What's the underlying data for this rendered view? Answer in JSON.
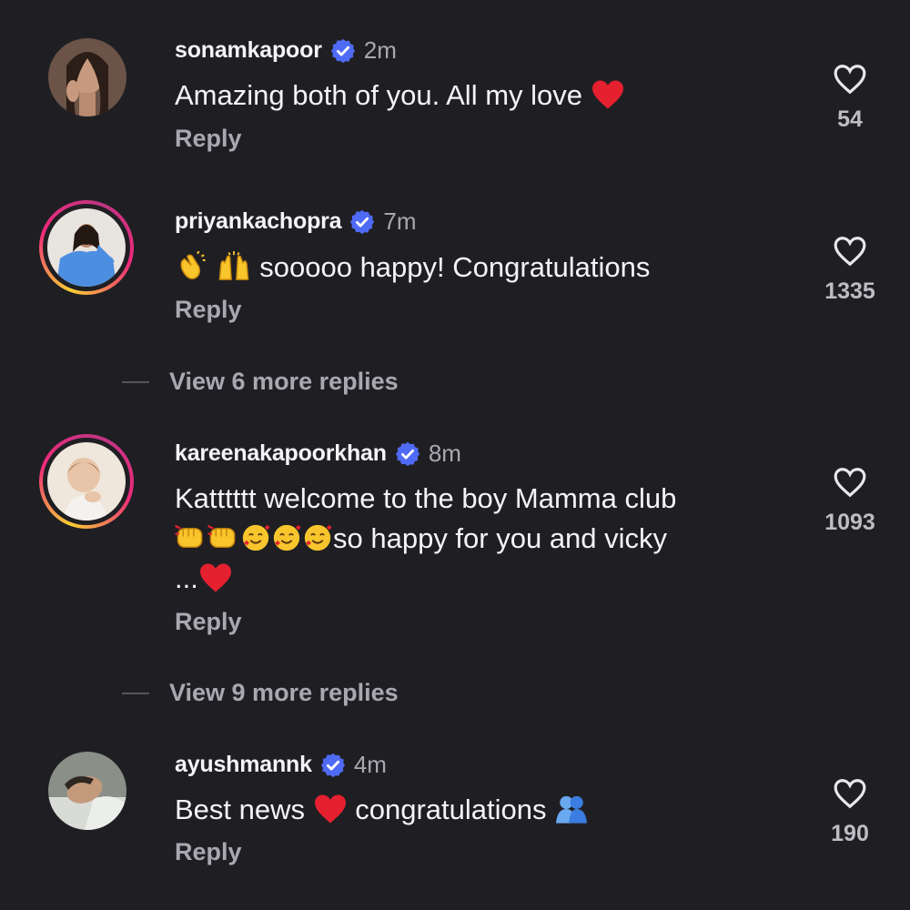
{
  "comments": [
    {
      "username": "sonamkapoor",
      "time": "2m",
      "text": "Amazing both of you. All my love",
      "reply_label": "Reply",
      "likes": "54",
      "story_ring": false,
      "emojis": [
        "red-heart"
      ]
    },
    {
      "username": "priyankachopra",
      "time": "7m",
      "text": "sooooo happy! Congratulations",
      "reply_label": "Reply",
      "likes": "1335",
      "story_ring": true,
      "emojis": [
        "clapping-hands",
        "raising-hands"
      ],
      "view_more": "View 6 more replies"
    },
    {
      "username": "kareenakapoorkhan",
      "time": "8m",
      "text_line1": "Katttttt welcome to the boy Mamma club",
      "text_line2": "so happy for you and vicky",
      "text_line3": "...",
      "reply_label": "Reply",
      "likes": "1093",
      "story_ring": true,
      "emojis": [
        "oncoming-fist",
        "oncoming-fist",
        "smiling-face-with-hearts",
        "smiling-face-with-hearts",
        "smiling-face-with-hearts",
        "red-heart"
      ],
      "view_more": "View 9 more replies"
    },
    {
      "username": "ayushmannk",
      "time": "4m",
      "text_part1": "Best news",
      "text_part2": "congratulations",
      "reply_label": "Reply",
      "likes": "190",
      "story_ring": false,
      "emojis": [
        "red-heart",
        "people-hugging"
      ]
    }
  ],
  "colors": {
    "background": "#1f1f23",
    "verified": "#4f6bf5",
    "muted_text": "#a8a8b0"
  },
  "icons": [
    "verified-badge-icon",
    "heart-outline-icon"
  ]
}
